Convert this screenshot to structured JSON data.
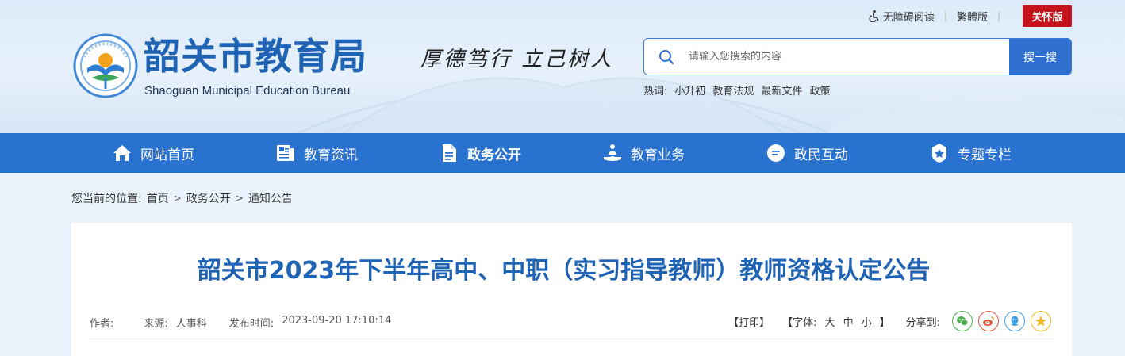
{
  "top_bar": {
    "accessibility_label": "无障碍阅读",
    "traditional_label": "繁體版",
    "care_mode_label": "关怀版"
  },
  "logo": {
    "name_cn": "韶关市教育局",
    "name_en": "Shaoguan Municipal Education Bureau"
  },
  "slogan": "厚德笃行  立己树人",
  "search": {
    "placeholder": "请输入您搜索的内容",
    "button_label": "搜一搜"
  },
  "hotwords": {
    "label": "热词:",
    "items": [
      "小升初",
      "教育法规",
      "最新文件",
      "政策"
    ]
  },
  "nav": {
    "items": [
      {
        "label": "网站首页",
        "icon": "home-icon"
      },
      {
        "label": "教育资讯",
        "icon": "news-icon"
      },
      {
        "label": "政务公开",
        "icon": "document-icon"
      },
      {
        "label": "教育业务",
        "icon": "service-icon"
      },
      {
        "label": "政民互动",
        "icon": "chat-icon"
      },
      {
        "label": "专题专栏",
        "icon": "badge-icon"
      }
    ],
    "active_index": 2
  },
  "breadcrumb": {
    "prefix": "您当前的位置:",
    "items": [
      "首页",
      "政务公开",
      "通知公告"
    ],
    "separator": ">"
  },
  "article": {
    "title": "韶关市2023年下半年高中、中职（实习指导教师）教师资格认定公告",
    "author_label": "作者:",
    "author": "",
    "source_label": "来源:",
    "source": "人事科",
    "publish_label": "发布时间:",
    "publish_time": "2023-09-20 17:10:14"
  },
  "tools": {
    "print_label": "【打印】",
    "font_prefix": "【字体:",
    "font_large": "大",
    "font_medium": "中",
    "font_small": "小",
    "font_suffix": "】",
    "share_label": "分享到:",
    "share_targets": [
      "wechat-icon",
      "weibo-icon",
      "qq-icon",
      "qzone-icon"
    ]
  },
  "colors": {
    "brand_blue": "#2a72cf",
    "title_blue": "#1f63b5",
    "care_red": "#c6121a"
  }
}
